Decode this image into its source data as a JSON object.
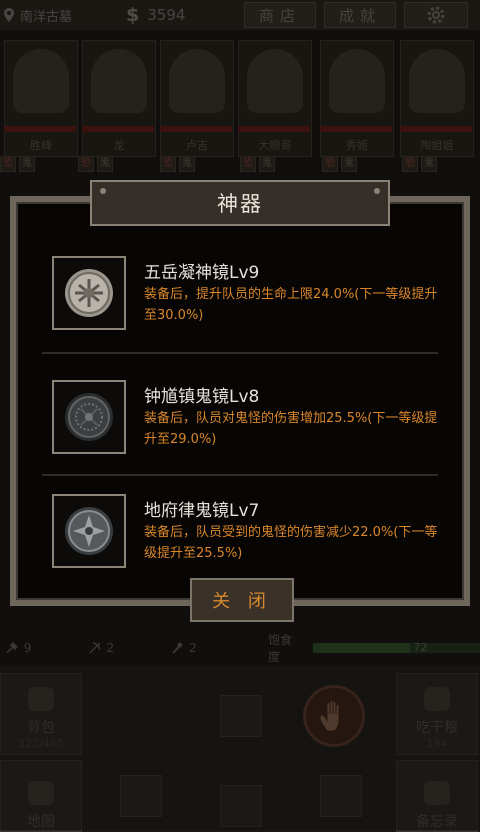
{
  "topbar": {
    "location": "南洋古墓",
    "money_symbol": "$",
    "money": "3594",
    "shop_label": "商店",
    "achievements_label": "成就",
    "settings_icon": "gear-icon"
  },
  "party": [
    {
      "name": "胜峰"
    },
    {
      "name": "龙"
    },
    {
      "name": "卢吉"
    },
    {
      "name": "大眼哥"
    },
    {
      "name": "秀姬"
    },
    {
      "name": "陶姐姐"
    }
  ],
  "tags": {
    "a": "恐",
    "b": "鬼"
  },
  "stats": {
    "shovel": "9",
    "pick": "2",
    "torch": "2",
    "satiety_label": "饱食度",
    "satiety": "72",
    "satiety_fraction": 0.58
  },
  "bottom": {
    "bag_label": "背包",
    "bag_count": "322/465",
    "eat_label": "吃干粮",
    "eat_count": "194",
    "map_label": "地图",
    "memo_label": "备忘录"
  },
  "modal": {
    "title": "神器",
    "items": [
      {
        "name": "五岳凝神镜Lv9",
        "desc": "装备后，提升队员的生命上限24.0%(下一等级提升至30.0%)"
      },
      {
        "name": "钟馗镇鬼镜Lv8",
        "desc": "装备后，队员对鬼怪的伤害增加25.5%(下一等级提升至29.0%)"
      },
      {
        "name": "地府律鬼镜Lv7",
        "desc": "装备后，队员受到的鬼怪的伤害减少22.0%(下一等级提升至25.5%)"
      }
    ],
    "close_label": "关 闭"
  },
  "colors": {
    "accent": "#d9862b",
    "frame": "#6e665a",
    "hp": "#5b1c16"
  }
}
